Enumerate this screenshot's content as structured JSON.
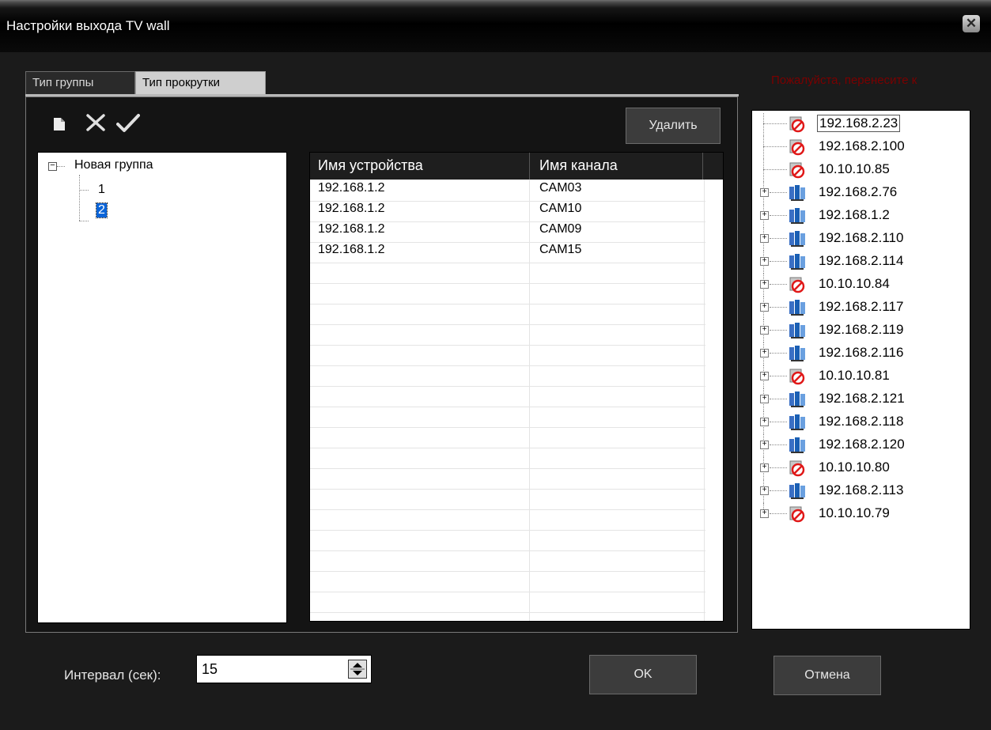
{
  "window": {
    "title": "Настройки выхода TV wall",
    "close_icon": "close-icon"
  },
  "tabs": [
    {
      "label": "Тип группы"
    },
    {
      "label": "Тип прокрутки"
    }
  ],
  "hint": "Пожалуйста, перенесите к",
  "toolbar": {
    "new_icon": "new-file-icon",
    "delete_icon": "delete-x-icon",
    "confirm_icon": "checkmark-icon",
    "delete_button": "Удалить"
  },
  "group_tree": {
    "root": "Новая группа",
    "children": [
      "1",
      "2"
    ],
    "selected": "2"
  },
  "table": {
    "columns": [
      "Имя устройства",
      "Имя канала"
    ],
    "rows": [
      [
        "192.168.1.2",
        "CAM03"
      ],
      [
        "192.168.1.2",
        "CAM10"
      ],
      [
        "192.168.1.2",
        "CAM09"
      ],
      [
        "192.168.1.2",
        "CAM15"
      ]
    ]
  },
  "device_tree": [
    {
      "label": "192.168.2.23",
      "status": "offline",
      "expandable": false
    },
    {
      "label": "192.168.2.100",
      "status": "offline",
      "expandable": false
    },
    {
      "label": "10.10.10.85",
      "status": "offline",
      "expandable": false
    },
    {
      "label": "192.168.2.76",
      "status": "online",
      "expandable": true
    },
    {
      "label": "192.168.1.2",
      "status": "online",
      "expandable": true
    },
    {
      "label": "192.168.2.110",
      "status": "online",
      "expandable": true
    },
    {
      "label": "192.168.2.114",
      "status": "online",
      "expandable": true
    },
    {
      "label": "10.10.10.84",
      "status": "offline",
      "expandable": true
    },
    {
      "label": "192.168.2.117",
      "status": "online",
      "expandable": true
    },
    {
      "label": "192.168.2.119",
      "status": "online",
      "expandable": true
    },
    {
      "label": "192.168.2.116",
      "status": "online",
      "expandable": true
    },
    {
      "label": "10.10.10.81",
      "status": "offline",
      "expandable": true
    },
    {
      "label": "192.168.2.121",
      "status": "online",
      "expandable": true
    },
    {
      "label": "192.168.2.118",
      "status": "online",
      "expandable": true
    },
    {
      "label": "192.168.2.120",
      "status": "online",
      "expandable": true
    },
    {
      "label": "10.10.10.80",
      "status": "offline",
      "expandable": true
    },
    {
      "label": "192.168.2.113",
      "status": "online",
      "expandable": true
    },
    {
      "label": "10.10.10.79",
      "status": "offline",
      "expandable": true
    }
  ],
  "interval": {
    "label": "Интервал (сек):",
    "value": "15"
  },
  "buttons": {
    "ok": "OK",
    "cancel": "Отмена"
  },
  "colors": {
    "background": "#1b1b1b",
    "hint": "#7a0000",
    "selection": "#0a64d8",
    "offline": "#e01818",
    "online": "#1a5fb4"
  }
}
